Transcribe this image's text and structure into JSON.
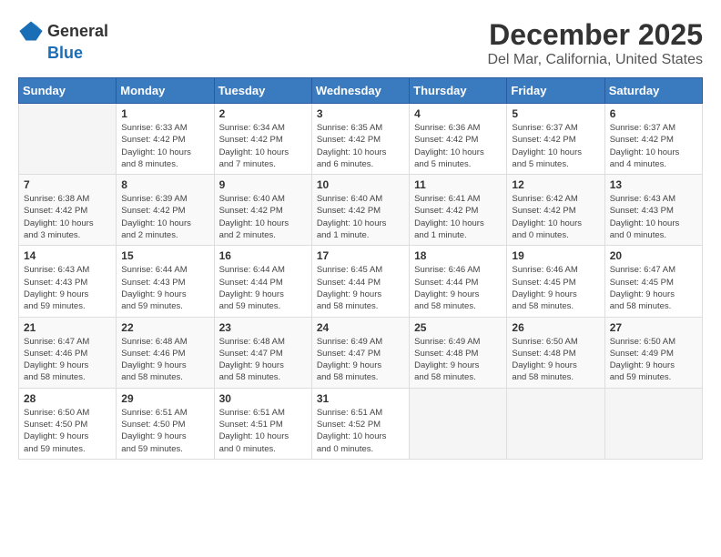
{
  "header": {
    "logo_line1": "General",
    "logo_line2": "Blue",
    "title": "December 2025",
    "subtitle": "Del Mar, California, United States"
  },
  "calendar": {
    "days_of_week": [
      "Sunday",
      "Monday",
      "Tuesday",
      "Wednesday",
      "Thursday",
      "Friday",
      "Saturday"
    ],
    "weeks": [
      [
        {
          "day": "",
          "info": ""
        },
        {
          "day": "1",
          "info": "Sunrise: 6:33 AM\nSunset: 4:42 PM\nDaylight: 10 hours\nand 8 minutes."
        },
        {
          "day": "2",
          "info": "Sunrise: 6:34 AM\nSunset: 4:42 PM\nDaylight: 10 hours\nand 7 minutes."
        },
        {
          "day": "3",
          "info": "Sunrise: 6:35 AM\nSunset: 4:42 PM\nDaylight: 10 hours\nand 6 minutes."
        },
        {
          "day": "4",
          "info": "Sunrise: 6:36 AM\nSunset: 4:42 PM\nDaylight: 10 hours\nand 5 minutes."
        },
        {
          "day": "5",
          "info": "Sunrise: 6:37 AM\nSunset: 4:42 PM\nDaylight: 10 hours\nand 5 minutes."
        },
        {
          "day": "6",
          "info": "Sunrise: 6:37 AM\nSunset: 4:42 PM\nDaylight: 10 hours\nand 4 minutes."
        }
      ],
      [
        {
          "day": "7",
          "info": "Sunrise: 6:38 AM\nSunset: 4:42 PM\nDaylight: 10 hours\nand 3 minutes."
        },
        {
          "day": "8",
          "info": "Sunrise: 6:39 AM\nSunset: 4:42 PM\nDaylight: 10 hours\nand 2 minutes."
        },
        {
          "day": "9",
          "info": "Sunrise: 6:40 AM\nSunset: 4:42 PM\nDaylight: 10 hours\nand 2 minutes."
        },
        {
          "day": "10",
          "info": "Sunrise: 6:40 AM\nSunset: 4:42 PM\nDaylight: 10 hours\nand 1 minute."
        },
        {
          "day": "11",
          "info": "Sunrise: 6:41 AM\nSunset: 4:42 PM\nDaylight: 10 hours\nand 1 minute."
        },
        {
          "day": "12",
          "info": "Sunrise: 6:42 AM\nSunset: 4:42 PM\nDaylight: 10 hours\nand 0 minutes."
        },
        {
          "day": "13",
          "info": "Sunrise: 6:43 AM\nSunset: 4:43 PM\nDaylight: 10 hours\nand 0 minutes."
        }
      ],
      [
        {
          "day": "14",
          "info": "Sunrise: 6:43 AM\nSunset: 4:43 PM\nDaylight: 9 hours\nand 59 minutes."
        },
        {
          "day": "15",
          "info": "Sunrise: 6:44 AM\nSunset: 4:43 PM\nDaylight: 9 hours\nand 59 minutes."
        },
        {
          "day": "16",
          "info": "Sunrise: 6:44 AM\nSunset: 4:44 PM\nDaylight: 9 hours\nand 59 minutes."
        },
        {
          "day": "17",
          "info": "Sunrise: 6:45 AM\nSunset: 4:44 PM\nDaylight: 9 hours\nand 58 minutes."
        },
        {
          "day": "18",
          "info": "Sunrise: 6:46 AM\nSunset: 4:44 PM\nDaylight: 9 hours\nand 58 minutes."
        },
        {
          "day": "19",
          "info": "Sunrise: 6:46 AM\nSunset: 4:45 PM\nDaylight: 9 hours\nand 58 minutes."
        },
        {
          "day": "20",
          "info": "Sunrise: 6:47 AM\nSunset: 4:45 PM\nDaylight: 9 hours\nand 58 minutes."
        }
      ],
      [
        {
          "day": "21",
          "info": "Sunrise: 6:47 AM\nSunset: 4:46 PM\nDaylight: 9 hours\nand 58 minutes."
        },
        {
          "day": "22",
          "info": "Sunrise: 6:48 AM\nSunset: 4:46 PM\nDaylight: 9 hours\nand 58 minutes."
        },
        {
          "day": "23",
          "info": "Sunrise: 6:48 AM\nSunset: 4:47 PM\nDaylight: 9 hours\nand 58 minutes."
        },
        {
          "day": "24",
          "info": "Sunrise: 6:49 AM\nSunset: 4:47 PM\nDaylight: 9 hours\nand 58 minutes."
        },
        {
          "day": "25",
          "info": "Sunrise: 6:49 AM\nSunset: 4:48 PM\nDaylight: 9 hours\nand 58 minutes."
        },
        {
          "day": "26",
          "info": "Sunrise: 6:50 AM\nSunset: 4:48 PM\nDaylight: 9 hours\nand 58 minutes."
        },
        {
          "day": "27",
          "info": "Sunrise: 6:50 AM\nSunset: 4:49 PM\nDaylight: 9 hours\nand 59 minutes."
        }
      ],
      [
        {
          "day": "28",
          "info": "Sunrise: 6:50 AM\nSunset: 4:50 PM\nDaylight: 9 hours\nand 59 minutes."
        },
        {
          "day": "29",
          "info": "Sunrise: 6:51 AM\nSunset: 4:50 PM\nDaylight: 9 hours\nand 59 minutes."
        },
        {
          "day": "30",
          "info": "Sunrise: 6:51 AM\nSunset: 4:51 PM\nDaylight: 10 hours\nand 0 minutes."
        },
        {
          "day": "31",
          "info": "Sunrise: 6:51 AM\nSunset: 4:52 PM\nDaylight: 10 hours\nand 0 minutes."
        },
        {
          "day": "",
          "info": ""
        },
        {
          "day": "",
          "info": ""
        },
        {
          "day": "",
          "info": ""
        }
      ]
    ]
  }
}
